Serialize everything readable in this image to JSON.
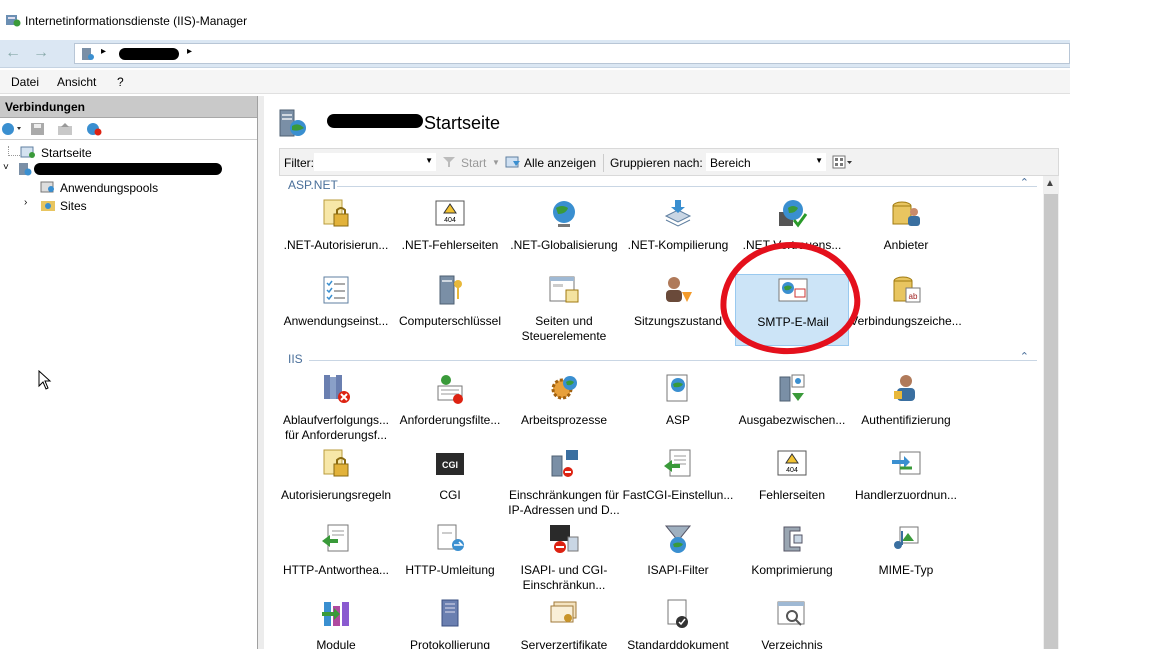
{
  "window": {
    "title": "Internetinformationsdienste (IIS)-Manager"
  },
  "nav": {
    "back": "←",
    "forward": "→",
    "sep": "▸",
    "sep2": "▸"
  },
  "menu": {
    "file": "Datei",
    "view": "Ansicht",
    "help": "?"
  },
  "connections": {
    "header": "Verbindungen",
    "tree": {
      "start": "Startseite",
      "pools": "Anwendungspools",
      "sites": "Sites"
    }
  },
  "main": {
    "title_suffix": "Startseite",
    "filter_label": "Filter:",
    "start_label": "Start",
    "show_all": "Alle anzeigen",
    "group_by_label": "Gruppieren nach:",
    "group_by_value": "Bereich"
  },
  "groups": {
    "aspnet": "ASP.NET",
    "iis": "IIS"
  },
  "aspnet_items": [
    {
      "label": ".NET-Autorisierun..."
    },
    {
      "label": ".NET-Fehlerseiten"
    },
    {
      "label": ".NET-Globalisierung"
    },
    {
      "label": ".NET-Kompilierung"
    },
    {
      "label": ".NET-Vertrauens..."
    },
    {
      "label": "Anbieter"
    },
    {
      "label": "Anwendungseinst..."
    },
    {
      "label": "Computerschlüssel"
    },
    {
      "label": "Seiten und Steuerelemente"
    },
    {
      "label": "Sitzungszustand"
    },
    {
      "label": "SMTP-E-Mail"
    },
    {
      "label": "Verbindungszeiche..."
    }
  ],
  "iis_items": [
    {
      "label": "Ablaufverfolgungs... für Anforderungsf..."
    },
    {
      "label": "Anforderungsfilte..."
    },
    {
      "label": "Arbeitsprozesse"
    },
    {
      "label": "ASP"
    },
    {
      "label": "Ausgabezwischen..."
    },
    {
      "label": "Authentifizierung"
    },
    {
      "label": "Autorisierungsregeln"
    },
    {
      "label": "CGI"
    },
    {
      "label": "Einschränkungen für IP-Adressen und D..."
    },
    {
      "label": "FastCGI-Einstellun..."
    },
    {
      "label": "Fehlerseiten"
    },
    {
      "label": "Handlerzuordnun..."
    },
    {
      "label": "HTTP-Antworthea..."
    },
    {
      "label": "HTTP-Umleitung"
    },
    {
      "label": "ISAPI- und CGI-Einschränkun..."
    },
    {
      "label": "ISAPI-Filter"
    },
    {
      "label": "Komprimierung"
    },
    {
      "label": "MIME-Typ"
    },
    {
      "label": "Module"
    },
    {
      "label": "Protokollierung"
    },
    {
      "label": "Serverzertifikate"
    },
    {
      "label": "Standarddokument"
    },
    {
      "label": "Verzeichnis"
    }
  ],
  "icon_badges": {
    "http404": "404",
    "cgi": "CGI",
    "ab": "ab"
  }
}
